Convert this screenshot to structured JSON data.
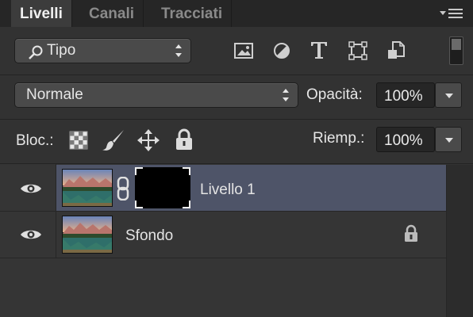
{
  "tabs": [
    {
      "label": "Livelli",
      "active": true
    },
    {
      "label": "Canali",
      "active": false
    },
    {
      "label": "Tracciati",
      "active": false
    }
  ],
  "filter": {
    "label": "Tipo",
    "icons": [
      "image-filter-icon",
      "adjustment-filter-icon",
      "type-filter-icon",
      "shape-filter-icon",
      "smart-object-filter-icon"
    ]
  },
  "blend": {
    "mode": "Normale",
    "opacity_label": "Opacità:",
    "opacity_value": "100%"
  },
  "lock": {
    "label": "Bloc.:",
    "fill_label": "Riemp.:",
    "fill_value": "100%",
    "icons": [
      "lock-transparency-icon",
      "lock-image-icon",
      "lock-position-icon",
      "lock-all-icon"
    ]
  },
  "layers": [
    {
      "name": "Livello 1",
      "selected": true,
      "visible": true,
      "has_mask": true,
      "locked": false
    },
    {
      "name": "Sfondo",
      "selected": false,
      "visible": true,
      "has_mask": false,
      "locked": true
    }
  ],
  "colors": {
    "panel_bg": "#323232",
    "selected_row": "#4e5468",
    "tab_active": "#3c3c3c"
  }
}
